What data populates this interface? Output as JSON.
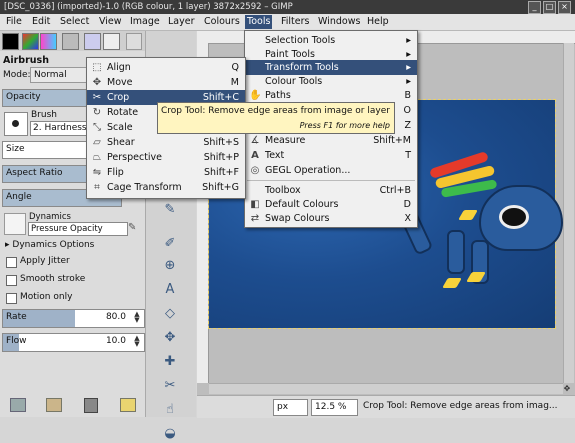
{
  "window": {
    "title": "[DSC_0336] (imported)-1.0 (RGB colour, 1 layer) 3872x2592 – GIMP",
    "controls": [
      "_",
      "□",
      "×"
    ]
  },
  "menubar": [
    "File",
    "Edit",
    "Select",
    "View",
    "Image",
    "Layer",
    "Colours",
    "Tools",
    "Filters",
    "Windows",
    "Help"
  ],
  "tool_options": {
    "title": "Airbrush",
    "mode_label": "Mode:",
    "mode_value": "Normal",
    "opacity_label": "Opacity",
    "brush_label": "Brush",
    "brush_value": "2. Hardness 050",
    "size_label": "Size",
    "aspect_label": "Aspect Ratio",
    "angle_label": "Angle",
    "dynamics_label": "Dynamics",
    "dynamics_value": "Pressure Opacity",
    "dynamics_options": "Dynamics Options",
    "apply_jitter": "Apply Jitter",
    "smooth_stroke": "Smooth stroke",
    "motion_only": "Motion only",
    "rate_label": "Rate",
    "rate_value": "80.0",
    "flow_label": "Flow",
    "flow_value": "10.0"
  },
  "tools_menu": {
    "items": [
      {
        "label": "Selection Tools",
        "arrow": "▸"
      },
      {
        "label": "Paint Tools",
        "arrow": "▸"
      },
      {
        "label": "Transform Tools",
        "arrow": "▸"
      },
      {
        "label": "Colour Tools",
        "arrow": "▸"
      },
      {
        "label": "Paths",
        "shortcut": "B"
      },
      {
        "label": "",
        "shortcut": "O"
      },
      {
        "label": "",
        "shortcut": "Z"
      },
      {
        "label": "Measure",
        "shortcut": "Shift+M"
      },
      {
        "label": "Text",
        "shortcut": "T"
      },
      {
        "label": "GEGL Operation...",
        "shortcut": ""
      },
      {
        "label": "Toolbox",
        "shortcut": "Ctrl+B"
      },
      {
        "label": "Default Colours",
        "shortcut": "D"
      },
      {
        "label": "Swap Colours",
        "shortcut": "X"
      }
    ]
  },
  "transform_menu": {
    "items": [
      {
        "label": "Align",
        "shortcut": "Q"
      },
      {
        "label": "Move",
        "shortcut": "M"
      },
      {
        "label": "Crop",
        "shortcut": "Shift+C"
      },
      {
        "label": "Rotate",
        "shortcut": ""
      },
      {
        "label": "Scale",
        "shortcut": ""
      },
      {
        "label": "Shear",
        "shortcut": "Shift+S"
      },
      {
        "label": "Perspective",
        "shortcut": "Shift+P"
      },
      {
        "label": "Flip",
        "shortcut": "Shift+F"
      },
      {
        "label": "Cage Transform",
        "shortcut": "Shift+G"
      }
    ]
  },
  "tooltip": {
    "text": "Crop Tool: Remove edge areas from image or layer",
    "hint": "Press F1 for more help"
  },
  "status": {
    "unit": "px",
    "zoom": "12.5 %",
    "message": "Crop Tool: Remove edge areas from imag..."
  }
}
